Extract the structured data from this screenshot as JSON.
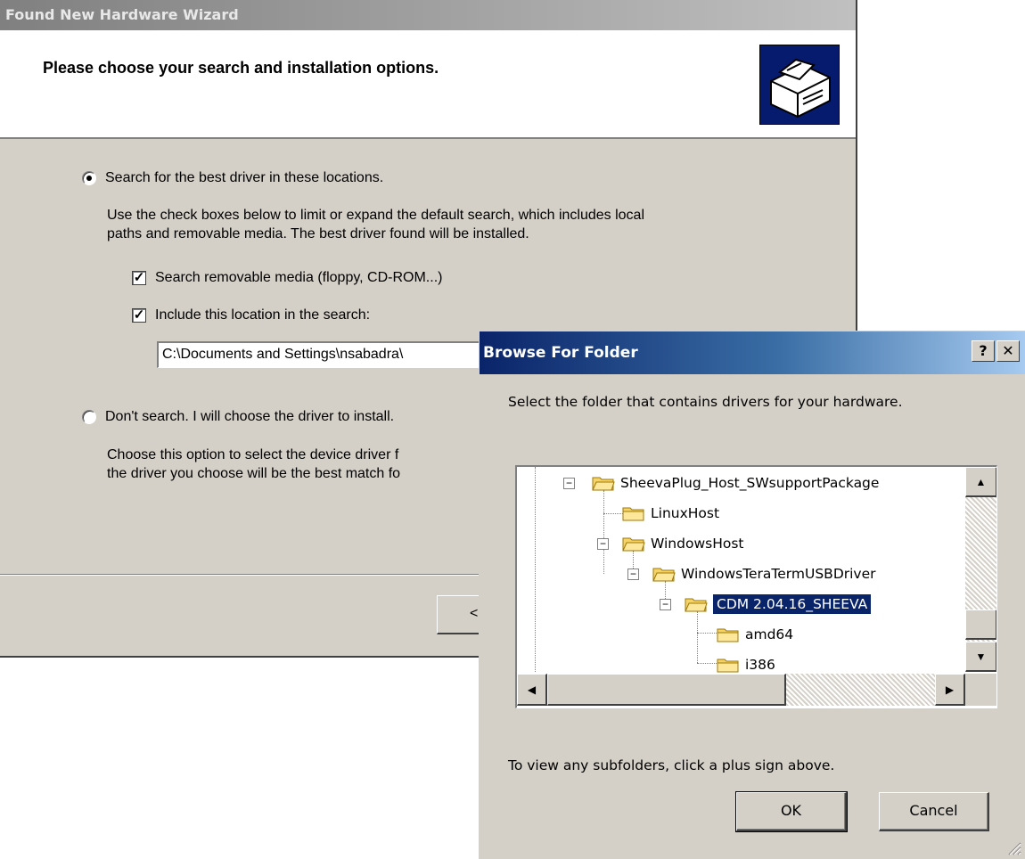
{
  "wizard": {
    "title": "Found New Hardware Wizard",
    "heading": "Please choose your search and installation options.",
    "icon": "hardware-icon",
    "option_search": {
      "label": "Search for the best driver in these locations.",
      "checked": true,
      "description_line1": "Use the check boxes below to limit or expand the default search, which includes local",
      "description_line2": "paths and removable media. The best driver found will be installed."
    },
    "check_removable": {
      "label": "Search removable media (floppy, CD-ROM...)",
      "checked": true
    },
    "check_location": {
      "label": "Include this location in the search:",
      "checked": true
    },
    "location_value": "C:\\Documents and Settings\\nsabadra\\",
    "option_manual": {
      "label": "Don't search. I will choose the driver to install.",
      "checked": false,
      "description_line1": "Choose this option to select the device driver f",
      "description_line2": "the driver you choose will be the best match fo"
    },
    "back_button_label": "<"
  },
  "browse": {
    "title": "Browse For Folder",
    "help_label": "?",
    "close_label": "✕",
    "prompt": "Select the folder that contains drivers for your hardware.",
    "tree": [
      {
        "label": "SheevaPlug_Host_SWsupportPackage",
        "expanded": true
      },
      {
        "label": "LinuxHost"
      },
      {
        "label": "WindowsHost",
        "expanded": true
      },
      {
        "label": "WindowsTeraTermUSBDriver",
        "expanded": true
      },
      {
        "label": "CDM 2.04.16_SHEEVA",
        "expanded": true,
        "selected": true
      },
      {
        "label": "amd64"
      },
      {
        "label": "i386"
      }
    ],
    "hint": "To view any subfolders, click a plus sign above.",
    "ok_label": "OK",
    "cancel_label": "Cancel"
  },
  "colors": {
    "selection": "#0a246a",
    "title_active": "#0a246a",
    "face": "#d4d0c8",
    "folder": "#f5d36b"
  }
}
